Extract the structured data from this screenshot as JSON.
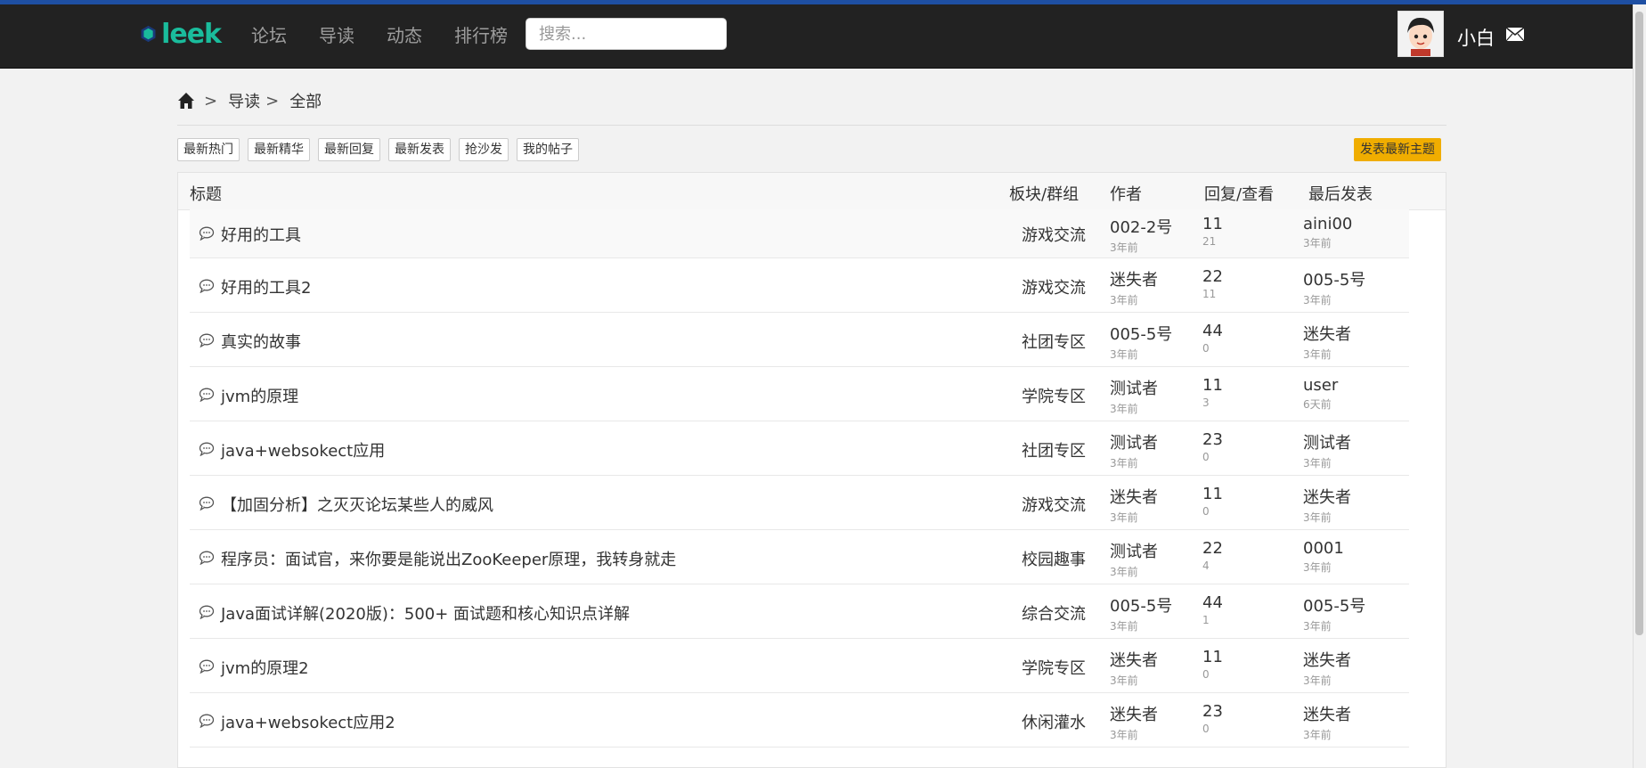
{
  "nav": {
    "logo_text": "leek",
    "links": [
      "论坛",
      "导读",
      "动态",
      "排行榜"
    ],
    "search_placeholder": "搜索...",
    "username": "小白"
  },
  "breadcrumb": {
    "items": [
      "导读",
      "全部"
    ],
    "separator": ">"
  },
  "filters": [
    "最新热门",
    "最新精华",
    "最新回复",
    "最新发表",
    "抢沙发",
    "我的帖子"
  ],
  "post_button": "发表最新主题",
  "table": {
    "headers": {
      "title": "标题",
      "board": "板块/群组",
      "author": "作者",
      "stats": "回复/查看",
      "last": "最后发表"
    },
    "rows": [
      {
        "title": "好用的工具",
        "board": "游戏交流",
        "author": "002-2号",
        "author_time": "3年前",
        "replies": "11",
        "views": "21",
        "last_user": "aini00",
        "last_time": "3年前"
      },
      {
        "title": "好用的工具2",
        "board": "游戏交流",
        "author": "迷失者",
        "author_time": "3年前",
        "replies": "22",
        "views": "11",
        "last_user": "005-5号",
        "last_time": "3年前"
      },
      {
        "title": "真实的故事",
        "board": "社团专区",
        "author": "005-5号",
        "author_time": "3年前",
        "replies": "44",
        "views": "0",
        "last_user": "迷失者",
        "last_time": "3年前"
      },
      {
        "title": "jvm的原理",
        "board": "学院专区",
        "author": "测试者",
        "author_time": "3年前",
        "replies": "11",
        "views": "3",
        "last_user": "user",
        "last_time": "6天前"
      },
      {
        "title": "java+websokect应用",
        "board": "社团专区",
        "author": "测试者",
        "author_time": "3年前",
        "replies": "23",
        "views": "0",
        "last_user": "测试者",
        "last_time": "3年前"
      },
      {
        "title": "【加固分析】之灭灭论坛某些人的威风",
        "board": "游戏交流",
        "author": "迷失者",
        "author_time": "3年前",
        "replies": "11",
        "views": "0",
        "last_user": "迷失者",
        "last_time": "3年前"
      },
      {
        "title": "程序员：面试官，来你要是能说出ZooKeeper原理，我转身就走",
        "board": "校园趣事",
        "author": "测试者",
        "author_time": "3年前",
        "replies": "22",
        "views": "4",
        "last_user": "0001",
        "last_time": "3年前"
      },
      {
        "title": "Java面试详解(2020版)：500+ 面试题和核心知识点详解",
        "board": "综合交流",
        "author": "005-5号",
        "author_time": "3年前",
        "replies": "44",
        "views": "1",
        "last_user": "005-5号",
        "last_time": "3年前"
      },
      {
        "title": "jvm的原理2",
        "board": "学院专区",
        "author": "迷失者",
        "author_time": "3年前",
        "replies": "11",
        "views": "0",
        "last_user": "迷失者",
        "last_time": "3年前"
      },
      {
        "title": "java+websokect应用2",
        "board": "休闲灌水",
        "author": "迷失者",
        "author_time": "3年前",
        "replies": "23",
        "views": "0",
        "last_user": "迷失者",
        "last_time": "3年前"
      }
    ]
  },
  "colors": {
    "navbar": "#222222",
    "accent_top": "#1e4fa3",
    "logo": "#1abc9c",
    "post_button": "#f0ad00"
  },
  "icons": {
    "logo": "hexagon-logo-icon",
    "home": "home-icon",
    "mail": "mail-icon",
    "row": "chat-bubble-icon"
  }
}
